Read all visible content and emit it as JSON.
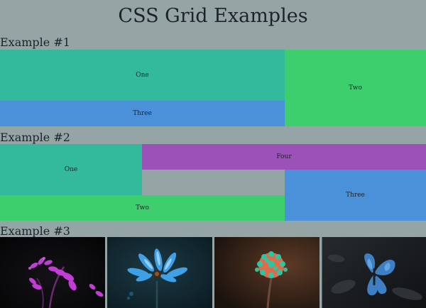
{
  "page": {
    "title": "CSS Grid Examples"
  },
  "example1": {
    "heading": "Example #1",
    "cells": {
      "one": "One",
      "two": "Two",
      "three": "Three"
    }
  },
  "example2": {
    "heading": "Example #2",
    "cells": {
      "one": "One",
      "two": "Two",
      "three": "Three",
      "four": "Four"
    }
  },
  "example3": {
    "heading": "Example #3",
    "photos": [
      {
        "subject": "magenta-flower-photo"
      },
      {
        "subject": "blue-daisy-photo"
      },
      {
        "subject": "teal-orange-flower-photo"
      },
      {
        "subject": "blue-butterfly-photo"
      }
    ]
  },
  "colors": {
    "background": "#95a5a6",
    "teal": "#33b99b",
    "green": "#3dcf6e",
    "blue": "#4a91d9",
    "purple": "#9b51b8"
  }
}
